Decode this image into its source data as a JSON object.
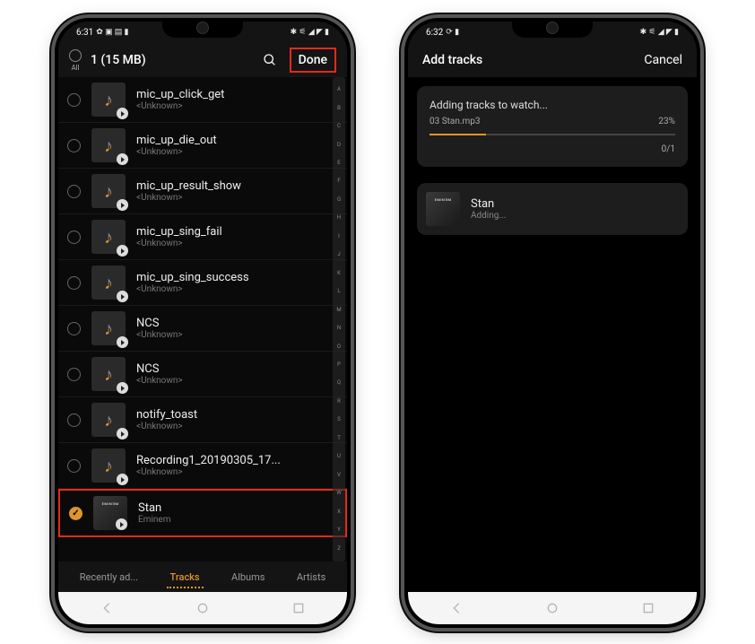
{
  "phone1": {
    "status": {
      "time": "6:31",
      "left_icons": "✿ ▣ ▤ ▮",
      "right_icons": "✱ ⚟ ◢ ◤ ▮"
    },
    "header": {
      "all_label": "All",
      "title": "1 (15 MB)",
      "done_label": "Done"
    },
    "tracks": [
      {
        "title": "mic_up_click_get",
        "sub": "<Unknown>",
        "checked": false,
        "type": "music"
      },
      {
        "title": "mic_up_die_out",
        "sub": "<Unknown>",
        "checked": false,
        "type": "music"
      },
      {
        "title": "mic_up_result_show",
        "sub": "<Unknown>",
        "checked": false,
        "type": "music"
      },
      {
        "title": "mic_up_sing_fail",
        "sub": "<Unknown>",
        "checked": false,
        "type": "music"
      },
      {
        "title": "mic_up_sing_success",
        "sub": "<Unknown>",
        "checked": false,
        "type": "music"
      },
      {
        "title": "NCS",
        "sub": "<Unknown>",
        "checked": false,
        "type": "music"
      },
      {
        "title": "NCS",
        "sub": "<Unknown>",
        "checked": false,
        "type": "music"
      },
      {
        "title": "notify_toast",
        "sub": "<Unknown>",
        "checked": false,
        "type": "music"
      },
      {
        "title": "Recording1_20190305_17...",
        "sub": "<Unknown>",
        "checked": false,
        "type": "music"
      },
      {
        "title": "Stan",
        "sub": "Eminem",
        "checked": true,
        "type": "album",
        "highlighted": true
      }
    ],
    "alpha_index": [
      "A",
      "B",
      "C",
      "D",
      "E",
      "F",
      "G",
      "H",
      "I",
      "J",
      "K",
      "L",
      "M",
      "N",
      "O",
      "P",
      "Q",
      "R",
      "S",
      "T",
      "U",
      "V",
      "W",
      "X",
      "Y",
      "Z"
    ],
    "tabs": [
      {
        "label": "Recently ad...",
        "active": false
      },
      {
        "label": "Tracks",
        "active": true
      },
      {
        "label": "Albums",
        "active": false
      },
      {
        "label": "Artists",
        "active": false
      }
    ]
  },
  "phone2": {
    "status": {
      "time": "6:32",
      "left_icons": "⟳ ▮",
      "right_icons": "✱ ⚟ ◢ ◤ ▮"
    },
    "header": {
      "title": "Add tracks",
      "cancel_label": "Cancel"
    },
    "progress": {
      "title": "Adding tracks to watch...",
      "file": "03 Stan.mp3",
      "percent_label": "23%",
      "percent": 23,
      "count": "0/1"
    },
    "item": {
      "title": "Stan",
      "sub": "Adding..."
    }
  }
}
